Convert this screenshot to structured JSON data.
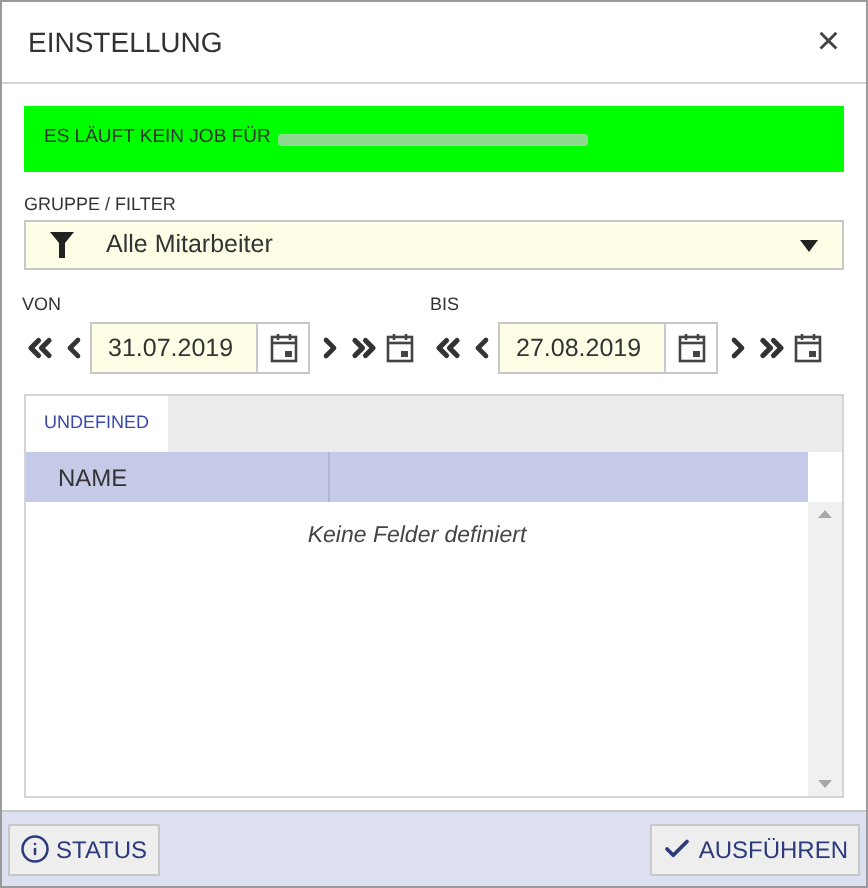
{
  "window": {
    "title": "EINSTELLUNG",
    "close": "×"
  },
  "banner": {
    "text": "ES LÄUFT KEIN JOB FÜR"
  },
  "filter": {
    "label": "GRUPPE / FILTER",
    "value": "Alle Mitarbeiter"
  },
  "dates": [
    {
      "label": "VON",
      "value": "31.07.2019"
    },
    {
      "label": "BIS",
      "value": "27.08.2019"
    }
  ],
  "tabs": [
    {
      "label": "UNDEFINED",
      "selected": true
    }
  ],
  "table": {
    "columns": [
      "NAME"
    ],
    "empty_text": "Keine Felder definiert"
  },
  "buttons": [
    {
      "kind": "info",
      "label": "STATUS"
    },
    {
      "kind": "run",
      "label": "AUSFÜHREN"
    }
  ]
}
